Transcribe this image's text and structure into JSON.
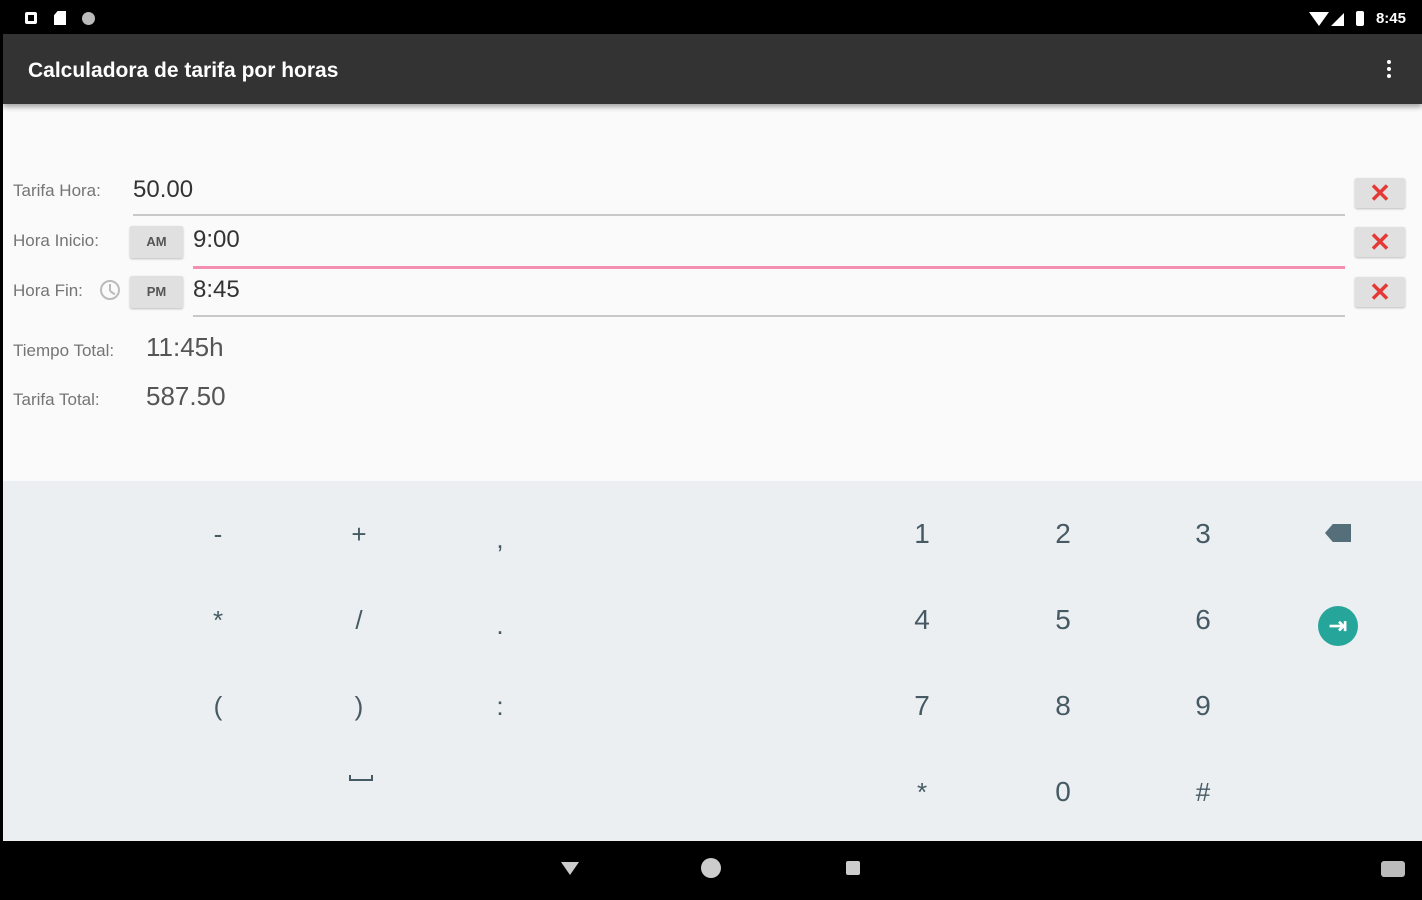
{
  "status_bar": {
    "time": "8:45",
    "icons": [
      "notification-box-icon",
      "sd-card-icon",
      "dot-icon",
      "wifi-icon",
      "signal-icon",
      "battery-icon"
    ]
  },
  "app_bar": {
    "title": "Calculadora de tarifa por horas",
    "overflow_icon": "overflow-menu-icon"
  },
  "form": {
    "tarifa_hora": {
      "label": "Tarifa Hora:",
      "value": "50.00"
    },
    "hora_inicio": {
      "label": "Hora Inicio:",
      "ampm": "AM",
      "value": "9:00"
    },
    "hora_fin": {
      "label": "Hora Fin:",
      "ampm": "PM",
      "value": "8:45"
    },
    "clear_symbol": "✕",
    "clear_color": "#e53935",
    "focus_color": "#f48fb1"
  },
  "results": {
    "tiempo_total": {
      "label": "Tiempo Total:",
      "value": "11:45h"
    },
    "tarifa_total": {
      "label": "Tarifa Total:",
      "value": "587.50"
    }
  },
  "keyboard": {
    "sym_keys": [
      "-",
      "+",
      ",",
      "*",
      "/",
      ".",
      "(",
      ")",
      ":"
    ],
    "num_keys": [
      "1",
      "2",
      "3",
      "4",
      "5",
      "6",
      "7",
      "8",
      "9",
      "*",
      "0",
      "#"
    ],
    "backspace_icon": "backspace-icon",
    "enter_icon": "next-field-icon",
    "enter_color": "#26a69a",
    "space_icon": "space-bar-icon"
  },
  "nav_bar": {
    "icons": [
      "back-icon",
      "home-icon",
      "recents-icon",
      "keyboard-switch-icon"
    ]
  }
}
